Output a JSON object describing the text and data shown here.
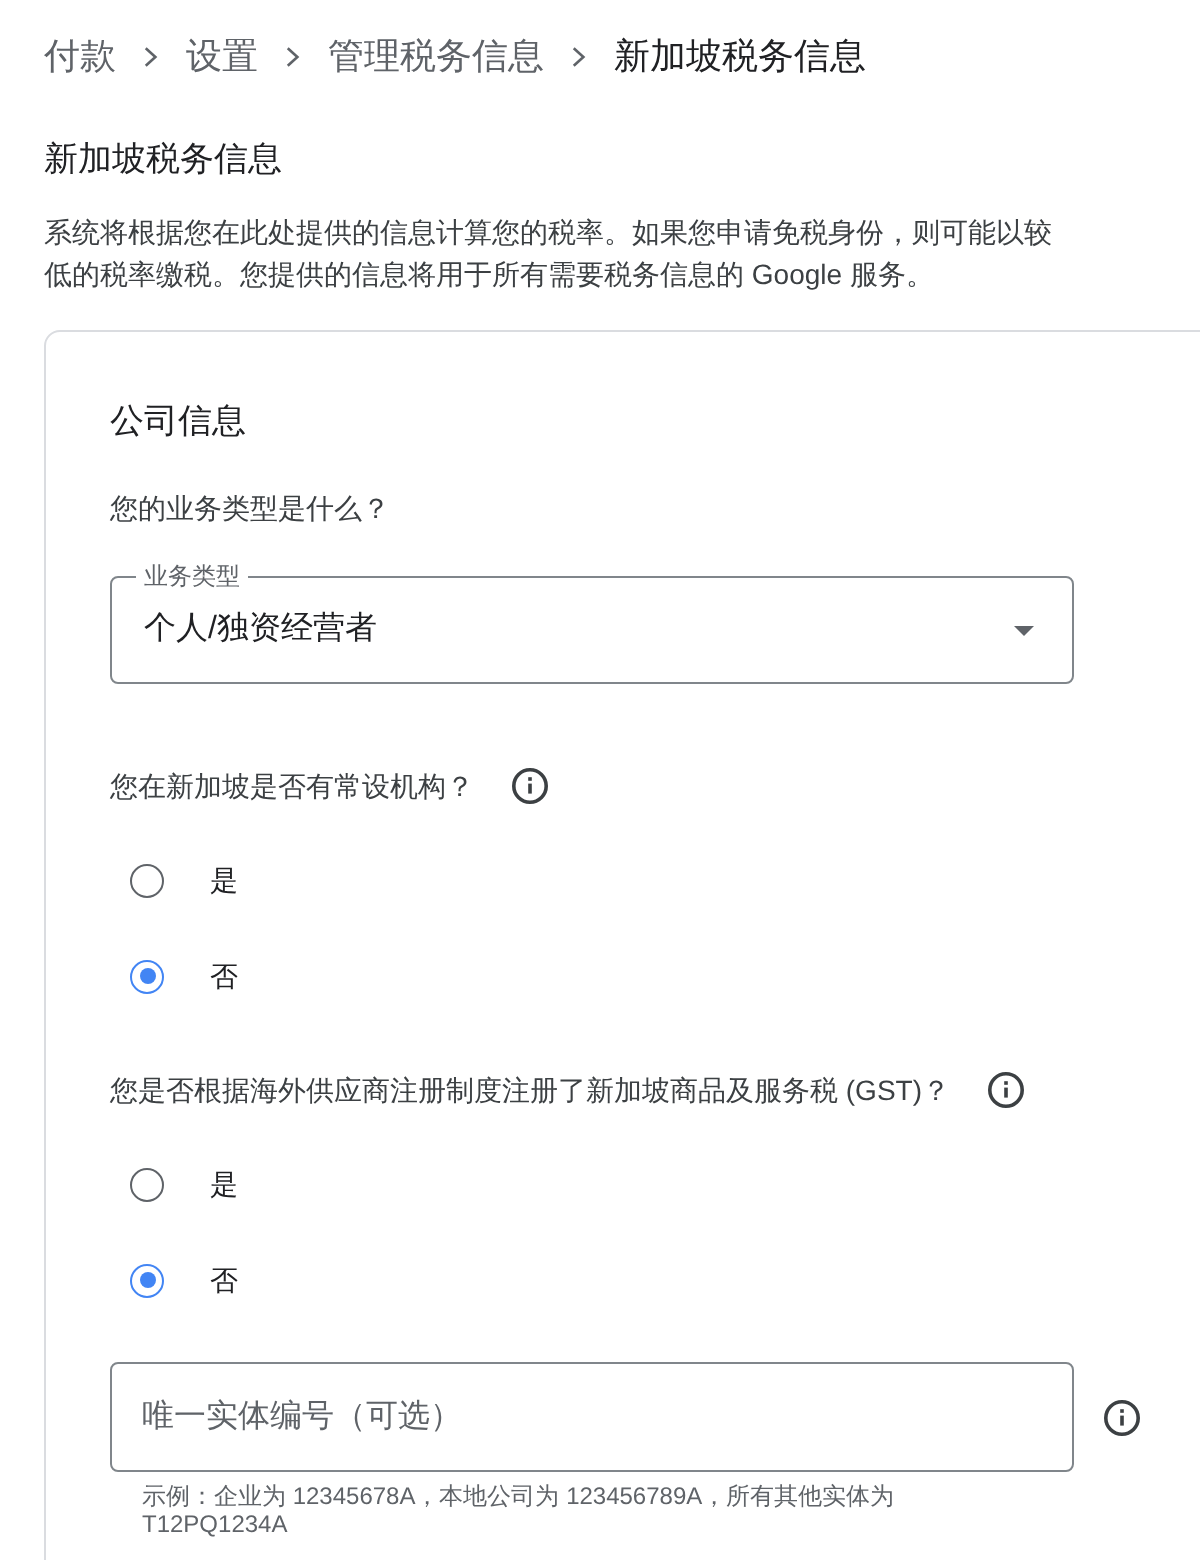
{
  "breadcrumb": [
    {
      "label": "付款",
      "current": false
    },
    {
      "label": "设置",
      "current": false
    },
    {
      "label": "管理税务信息",
      "current": false
    },
    {
      "label": "新加坡税务信息",
      "current": true
    }
  ],
  "page_title": "新加坡税务信息",
  "description": "系统将根据您在此处提供的信息计算您的税率。如果您申请免税身份，则可能以较低的税率缴税。您提供的信息将用于所有需要税务信息的 Google 服务。",
  "card": {
    "title": "公司信息",
    "fields": [
      {
        "kind": "select",
        "question": "您的业务类型是什么？",
        "label": "业务类型",
        "value": "个人/独资经营者"
      },
      {
        "kind": "radio",
        "question": "您在新加坡是否有常设机构？",
        "info": true,
        "options": [
          {
            "label": "是",
            "selected": false
          },
          {
            "label": "否",
            "selected": true
          }
        ]
      },
      {
        "kind": "radio",
        "question": "您是否根据海外供应商注册制度注册了新加坡商品及服务税 (GST)？",
        "info": true,
        "options": [
          {
            "label": "是",
            "selected": false
          },
          {
            "label": "否",
            "selected": true
          }
        ]
      },
      {
        "kind": "text",
        "placeholder": "唯一实体编号（可选）",
        "info": true,
        "hint": "示例：企业为 12345678A，本地公司为 123456789A，所有其他实体为 T12PQ1234A"
      }
    ]
  }
}
